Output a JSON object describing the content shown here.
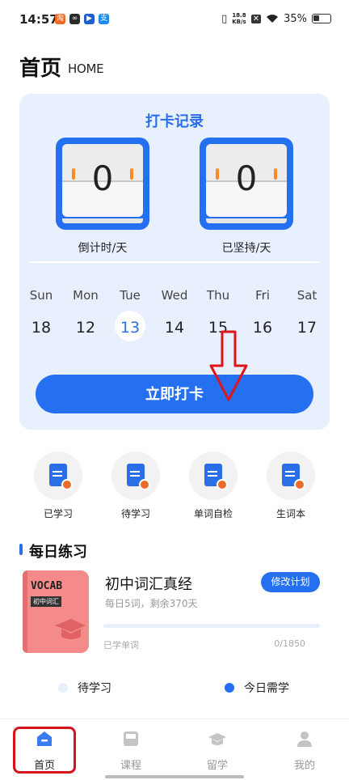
{
  "status_bar": {
    "time": "14:57",
    "net_speed_value": "18.8",
    "net_speed_unit": "KB/s",
    "battery": "35%"
  },
  "header": {
    "title": "首页",
    "subtitle": "HOME"
  },
  "checkin": {
    "title": "打卡记录",
    "countdown_value": "0",
    "countdown_label": "倒计时/天",
    "streak_value": "0",
    "streak_label": "已坚持/天",
    "weekdays": [
      "Sun",
      "Mon",
      "Tue",
      "Wed",
      "Thu",
      "Fri",
      "Sat"
    ],
    "dates": [
      "18",
      "12",
      "13",
      "14",
      "15",
      "16",
      "17"
    ],
    "today_index": 2,
    "button_label": "立即打卡"
  },
  "quick_actions": [
    {
      "label": "已学习",
      "icon": "doc-pencil-icon"
    },
    {
      "label": "待学习",
      "icon": "doc-clock-icon"
    },
    {
      "label": "单词自检",
      "icon": "doc-search-icon"
    },
    {
      "label": "生词本",
      "icon": "doc-minus-icon"
    }
  ],
  "daily_practice": {
    "title": "每日练习",
    "book": {
      "cover_title": "VOCAB",
      "cover_tag": "初中词汇"
    },
    "course_name": "初中词汇真经",
    "course_sub": "每日5词，剩余370天",
    "edit_button": "修改计划",
    "learned_label": "已学单词",
    "learned_count": "0/1850",
    "progress": 0,
    "legend": [
      {
        "label": "待学习",
        "color": "#e8effd"
      },
      {
        "label": "今日需学",
        "color": "#2470f0"
      }
    ]
  },
  "bottom_nav": {
    "items": [
      {
        "label": "首页",
        "icon": "home-icon"
      },
      {
        "label": "课程",
        "icon": "course-icon"
      },
      {
        "label": "留学",
        "icon": "graduation-cap-icon"
      },
      {
        "label": "我的",
        "icon": "user-icon"
      }
    ],
    "active_index": 0
  },
  "colors": {
    "accent": "#2470f0",
    "card_bg": "#e8effd",
    "highlight": "#d8141b"
  }
}
